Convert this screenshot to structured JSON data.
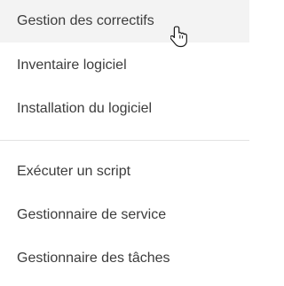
{
  "menu": {
    "group1": [
      {
        "label": "Gestion des correctifs",
        "hovered": true
      },
      {
        "label": "Inventaire logiciel",
        "hovered": false
      },
      {
        "label": "Installation du logiciel",
        "hovered": false
      }
    ],
    "group2": [
      {
        "label": "Exécuter un script",
        "hovered": false
      },
      {
        "label": "Gestionnaire de service",
        "hovered": false
      },
      {
        "label": "Gestionnaire des tâches",
        "hovered": false
      }
    ]
  },
  "colors": {
    "text": "#3c3c3c",
    "hover_background": "#f3f3f3",
    "divider": "#e2e2e2"
  },
  "cursor": {
    "icon": "hand-pointer-icon"
  }
}
